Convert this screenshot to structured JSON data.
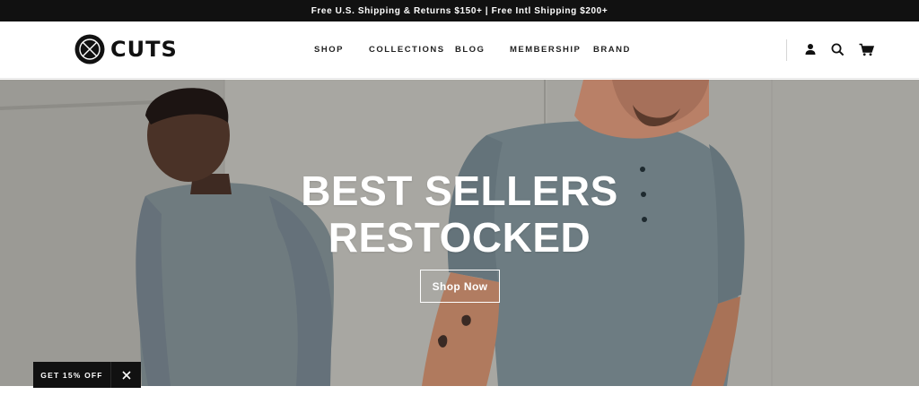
{
  "announcement": "Free U.S. Shipping & Returns $150+ | Free Intl Shipping $200+",
  "brand": {
    "name": "CUTS"
  },
  "nav": [
    {
      "label": "SHOP"
    },
    {
      "label": "COLLECTIONS"
    },
    {
      "label": "BLOG"
    },
    {
      "label": "MEMBERSHIP"
    },
    {
      "label": "BRAND"
    }
  ],
  "header_icons": [
    "account-icon",
    "search-icon",
    "cart-icon"
  ],
  "hero": {
    "title_line1": "BEST SELLERS",
    "title_line2": "RESTOCKED",
    "button": "Shop Now"
  },
  "promo": {
    "label": "GET 15% OFF",
    "close_icon": "close-icon"
  },
  "colors": {
    "bar": "#111111",
    "text": "#222222",
    "hero_text": "#ffffff"
  }
}
